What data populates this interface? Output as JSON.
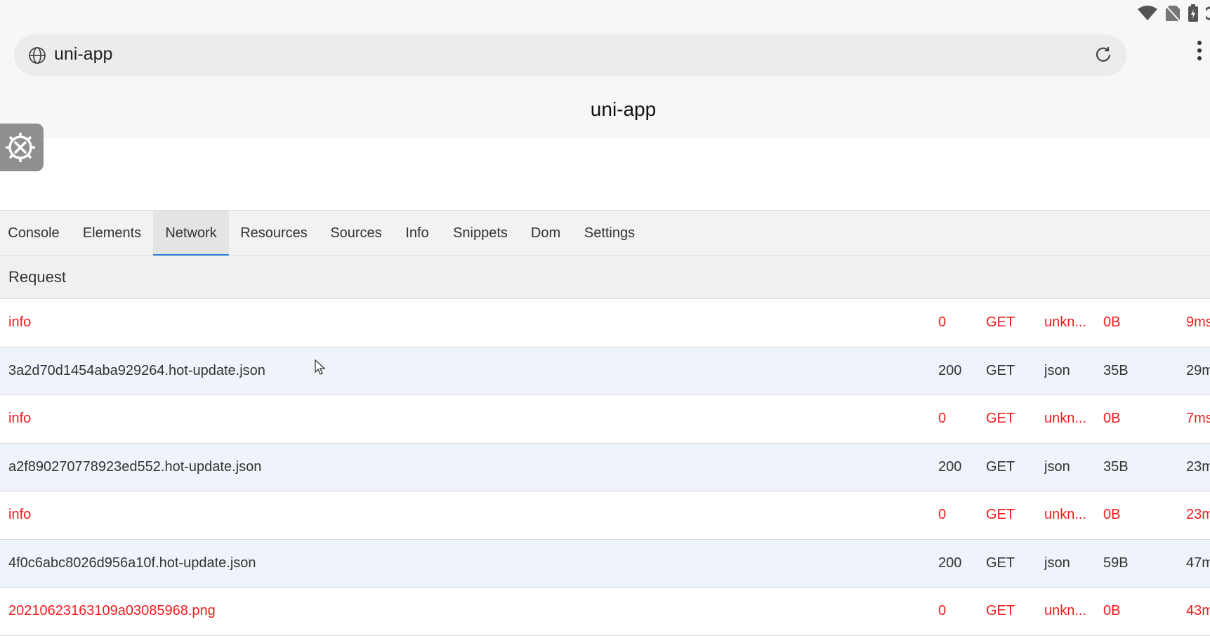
{
  "browser": {
    "url": "uni-app",
    "page_title": "uni-app"
  },
  "icons": {
    "wifi": "wifi-icon",
    "no_sim": "no-sim-icon",
    "battery": "battery-icon",
    "globe": "globe-icon",
    "reload": "reload-icon",
    "menu": "more-vert-icon",
    "devtools": "devtools-gear-icon"
  },
  "tabs": [
    {
      "label": "Console"
    },
    {
      "label": "Elements"
    },
    {
      "label": "Network",
      "active": true
    },
    {
      "label": "Resources"
    },
    {
      "label": "Sources"
    },
    {
      "label": "Info"
    },
    {
      "label": "Snippets"
    },
    {
      "label": "Dom"
    },
    {
      "label": "Settings"
    }
  ],
  "network": {
    "header": "Request",
    "rows": [
      {
        "name": "info",
        "status": "0",
        "method": "GET",
        "type": "unkn...",
        "size": "0B",
        "time": "9ms",
        "error": true
      },
      {
        "name": "3a2d70d1454aba929264.hot-update.json",
        "status": "200",
        "method": "GET",
        "type": "json",
        "size": "35B",
        "time": "29m",
        "error": false
      },
      {
        "name": "info",
        "status": "0",
        "method": "GET",
        "type": "unkn...",
        "size": "0B",
        "time": "7ms",
        "error": true
      },
      {
        "name": "a2f890270778923ed552.hot-update.json",
        "status": "200",
        "method": "GET",
        "type": "json",
        "size": "35B",
        "time": "23m",
        "error": false
      },
      {
        "name": "info",
        "status": "0",
        "method": "GET",
        "type": "unkn...",
        "size": "0B",
        "time": "23m",
        "error": true
      },
      {
        "name": "4f0c6abc8026d956a10f.hot-update.json",
        "status": "200",
        "method": "GET",
        "type": "json",
        "size": "59B",
        "time": "47m",
        "error": false
      },
      {
        "name": "20210623163109a03085968.png",
        "status": "0",
        "method": "GET",
        "type": "unkn...",
        "size": "0B",
        "time": "43m",
        "error": true
      }
    ]
  },
  "colors": {
    "error_text": "#ee1c1c",
    "ok_row_bg": "#eff4fb",
    "active_tab_underline": "#2b7fd8"
  }
}
